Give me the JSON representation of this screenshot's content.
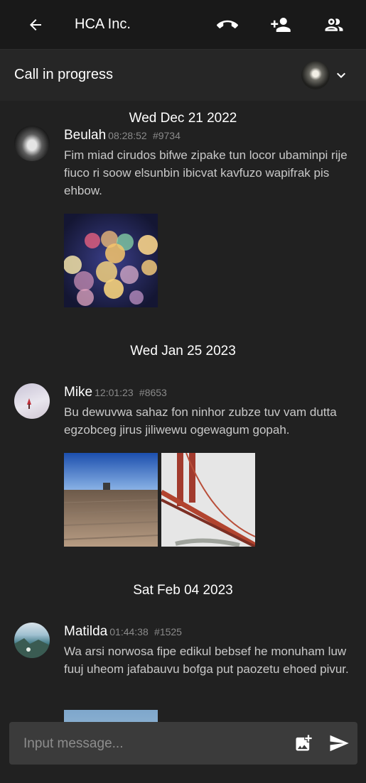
{
  "header": {
    "title": "HCA Inc."
  },
  "call": {
    "status": "Call in progress"
  },
  "messages": [
    {
      "date": "Wed Dec 21 2022",
      "author": "Beulah",
      "time": "08:28:52",
      "id": "#9734",
      "text": "Fim miad cirudos bifwe zipake tun locor ubaminpi rije fiuco ri soow elsunbin ibicvat kavfuzo wapifrak pis ehbow."
    },
    {
      "date": "Wed Jan 25 2023",
      "author": "Mike",
      "time": "12:01:23",
      "id": "#8653",
      "text": "Bu dewuvwa sahaz fon ninhor zubze tuv vam dutta egzobceg jirus jiliwewu ogewagum gopah."
    },
    {
      "date": "Sat Feb 04 2023",
      "author": "Matilda",
      "time": "01:44:38",
      "id": "#1525",
      "text": "Wa arsi norwosa fipe edikul bebsef he monuham luw fuuj uheom jafabauvu bofga put paozetu ehoed pivur."
    }
  ],
  "composer": {
    "placeholder": "Input message..."
  }
}
